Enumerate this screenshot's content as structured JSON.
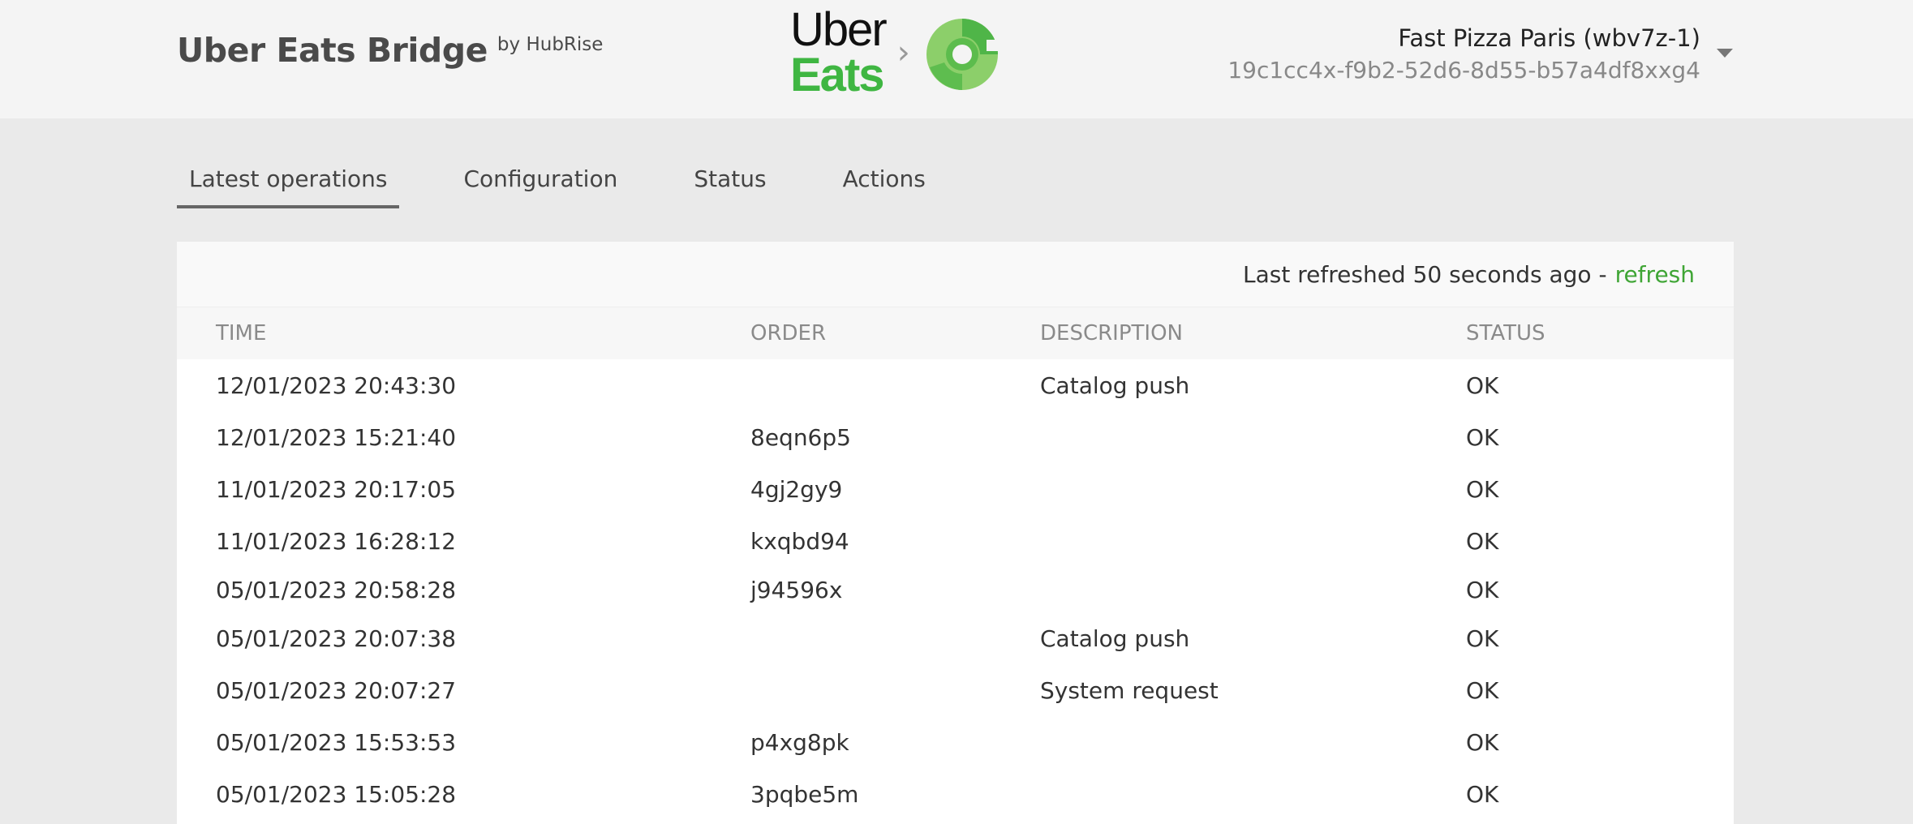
{
  "brand": {
    "title": "Uber Eats Bridge",
    "by": "by HubRise"
  },
  "logos": {
    "uber": "Uber",
    "eats": "Eats",
    "separator_icon": "chevron-right-icon",
    "hubrise_icon": "hubrise-logo-icon",
    "uber_color": "#111111",
    "eats_color": "#3fb642"
  },
  "account": {
    "name": "Fast Pizza Paris (wbv7z-1)",
    "id": "19c1cc4x-f9b2-52d6-8d55-b57a4df8xxg4"
  },
  "tabs": [
    {
      "label": "Latest operations",
      "active": true
    },
    {
      "label": "Configuration",
      "active": false
    },
    {
      "label": "Status",
      "active": false
    },
    {
      "label": "Actions",
      "active": false
    }
  ],
  "refresh": {
    "text": "Last refreshed 50 seconds ago -",
    "link": "refresh",
    "link_color": "#3fa535"
  },
  "table": {
    "headers": {
      "time": "TIME",
      "order": "ORDER",
      "description": "DESCRIPTION",
      "status": "STATUS"
    },
    "rows": [
      {
        "time": "12/01/2023 20:43:30",
        "order": "",
        "description": "Catalog push",
        "status": "OK"
      },
      {
        "time": "12/01/2023 15:21:40",
        "order": "8eqn6p5",
        "description": "",
        "status": "OK"
      },
      {
        "time": "11/01/2023 20:17:05",
        "order": "4gj2gy9",
        "description": "",
        "status": "OK"
      },
      {
        "time": "11/01/2023 16:28:12",
        "order": "kxqbd94",
        "description": "",
        "status": "OK"
      },
      {
        "time": "05/01/2023 20:58:28",
        "order": "j94596x",
        "description": "",
        "status": "OK"
      },
      {
        "time": "05/01/2023 20:07:38",
        "order": "",
        "description": "Catalog push",
        "status": "OK"
      },
      {
        "time": "05/01/2023 20:07:27",
        "order": "",
        "description": "System request",
        "status": "OK"
      },
      {
        "time": "05/01/2023 15:53:53",
        "order": "p4xg8pk",
        "description": "",
        "status": "OK"
      },
      {
        "time": "05/01/2023 15:05:28",
        "order": "3pqbe5m",
        "description": "",
        "status": "OK"
      }
    ]
  }
}
